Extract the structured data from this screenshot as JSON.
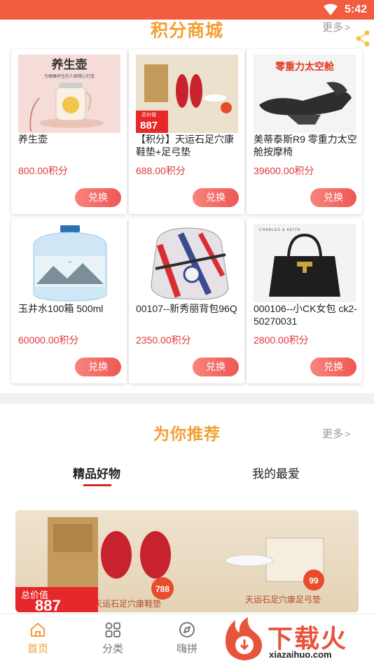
{
  "status_bar": {
    "time": "5:42"
  },
  "mall": {
    "title": "积分商城",
    "more": "更多",
    "products": [
      {
        "name": "养生壶",
        "price": "800.00积分",
        "button": "兑换",
        "image_text": "养生壶",
        "image_subtext": "为健康养生的人群精心打造"
      },
      {
        "name": "【积分】天运石足穴康鞋垫+足弓垫",
        "price": "688.00积分",
        "button": "兑换",
        "image_text": "887",
        "image_subtext": "总价值"
      },
      {
        "name": "美蒂泰斯R9 零重力太空舱按摩椅",
        "price": "39600.00积分",
        "button": "兑换",
        "image_text": "零重力太空舱"
      },
      {
        "name": "玉井水100箱 500ml",
        "price": "60000.00积分",
        "button": "兑换"
      },
      {
        "name": "00107--新秀丽背包96Q",
        "price": "2350.00积分",
        "button": "兑换"
      },
      {
        "name": "000106--小CK女包 ck2-50270031",
        "price": "2800.00积分",
        "button": "兑换",
        "image_text": "CHARLES & KEITH"
      }
    ]
  },
  "recommend": {
    "title": "为你推荐",
    "more": "更多",
    "tabs": [
      {
        "label": "精品好物",
        "active": true
      },
      {
        "label": "我的最爱",
        "active": false
      }
    ],
    "banner": {
      "left_caption": "天运石足穴康鞋垫",
      "right_caption": "天运石足穴康足弓垫",
      "total_label": "总价值",
      "total_value": "887",
      "badge_left": "788",
      "badge_right": "99"
    }
  },
  "tabbar": {
    "items": [
      {
        "label": "首页",
        "icon": "home-icon",
        "active": true
      },
      {
        "label": "分类",
        "icon": "grid-icon",
        "active": false
      },
      {
        "label": "嗨拼",
        "icon": "compass-icon",
        "active": false
      }
    ]
  },
  "watermark": {
    "text": "下载火",
    "url": "xiazaihuo.com"
  },
  "colors": {
    "status_bar": "#f25c3f",
    "accent_orange": "#f2a033",
    "price_red": "#e0373b",
    "button": "#ee5753",
    "tab_active": "#f29c38"
  }
}
